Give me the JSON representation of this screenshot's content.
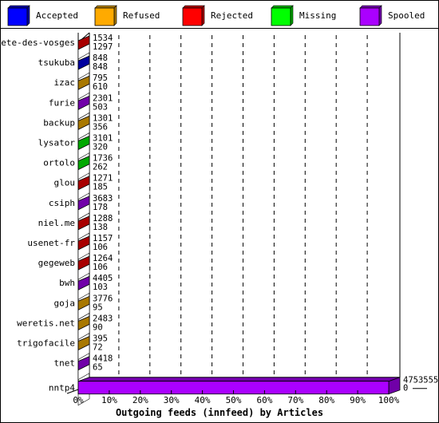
{
  "chart_data": {
    "type": "bar",
    "orientation": "horizontal",
    "title": "",
    "xlabel": "Outgoing feeds (innfeed) by Articles",
    "ylabel": "",
    "xlim": [
      0,
      100
    ],
    "x_unit": "%",
    "x_ticks": [
      "0%",
      "10%",
      "20%",
      "30%",
      "40%",
      "50%",
      "60%",
      "70%",
      "80%",
      "90%",
      "100%"
    ],
    "grid": "vertical-dashed",
    "legend_position": "top",
    "legend": [
      {
        "name": "Accepted",
        "color": "#0000ff",
        "dark": "#00009e"
      },
      {
        "name": "Refused",
        "color": "#ffaa00",
        "dark": "#a87800"
      },
      {
        "name": "Rejected",
        "color": "#ff0000",
        "dark": "#a80000"
      },
      {
        "name": "Missing",
        "color": "#00ff00",
        "dark": "#00a800"
      },
      {
        "name": "Spooled",
        "color": "#aa00ff",
        "dark": "#7000a8"
      }
    ],
    "categories": [
      "bete-des-vosges",
      "tsukuba",
      "izac",
      "furie",
      "backup",
      "lysator",
      "ortolo",
      "glou",
      "csiph",
      "niel.me",
      "usenet-fr",
      "gegeweb",
      "bwh",
      "goja",
      "weretis.net",
      "trigofacile",
      "tnet",
      "nntp4"
    ],
    "bars": [
      {
        "name": "bete-des-vosges",
        "label_top": "1534",
        "label_bottom": "1297",
        "series": "Rejected",
        "percent": 0.03
      },
      {
        "name": "tsukuba",
        "label_top": "848",
        "label_bottom": "848",
        "series": "Accepted",
        "percent": 0.02
      },
      {
        "name": "izac",
        "label_top": "795",
        "label_bottom": "610",
        "series": "Refused",
        "percent": 0.02
      },
      {
        "name": "furie",
        "label_top": "2301",
        "label_bottom": "503",
        "series": "Spooled",
        "percent": 0.05
      },
      {
        "name": "backup",
        "label_top": "1301",
        "label_bottom": "356",
        "series": "Refused",
        "percent": 0.03
      },
      {
        "name": "lysator",
        "label_top": "3101",
        "label_bottom": "320",
        "series": "Missing",
        "percent": 0.07
      },
      {
        "name": "ortolo",
        "label_top": "1736",
        "label_bottom": "262",
        "series": "Missing",
        "percent": 0.04
      },
      {
        "name": "glou",
        "label_top": "1271",
        "label_bottom": "185",
        "series": "Rejected",
        "percent": 0.03
      },
      {
        "name": "csiph",
        "label_top": "3683",
        "label_bottom": "178",
        "series": "Spooled",
        "percent": 0.08
      },
      {
        "name": "niel.me",
        "label_top": "1288",
        "label_bottom": "138",
        "series": "Rejected",
        "percent": 0.03
      },
      {
        "name": "usenet-fr",
        "label_top": "1157",
        "label_bottom": "106",
        "series": "Rejected",
        "percent": 0.02
      },
      {
        "name": "gegeweb",
        "label_top": "1264",
        "label_bottom": "106",
        "series": "Rejected",
        "percent": 0.03
      },
      {
        "name": "bwh",
        "label_top": "4405",
        "label_bottom": "103",
        "series": "Spooled",
        "percent": 0.09
      },
      {
        "name": "goja",
        "label_top": "3776",
        "label_bottom": "95",
        "series": "Refused",
        "percent": 0.08
      },
      {
        "name": "weretis.net",
        "label_top": "2483",
        "label_bottom": "90",
        "series": "Refused",
        "percent": 0.05
      },
      {
        "name": "trigofacile",
        "label_top": "395",
        "label_bottom": "72",
        "series": "Refused",
        "percent": 0.01
      },
      {
        "name": "tnet",
        "label_top": "4418",
        "label_bottom": "65",
        "series": "Spooled",
        "percent": 0.09
      },
      {
        "name": "nntp4",
        "label_top": "4753555",
        "label_bottom": "0",
        "series": "Spooled",
        "percent": 100
      }
    ]
  }
}
